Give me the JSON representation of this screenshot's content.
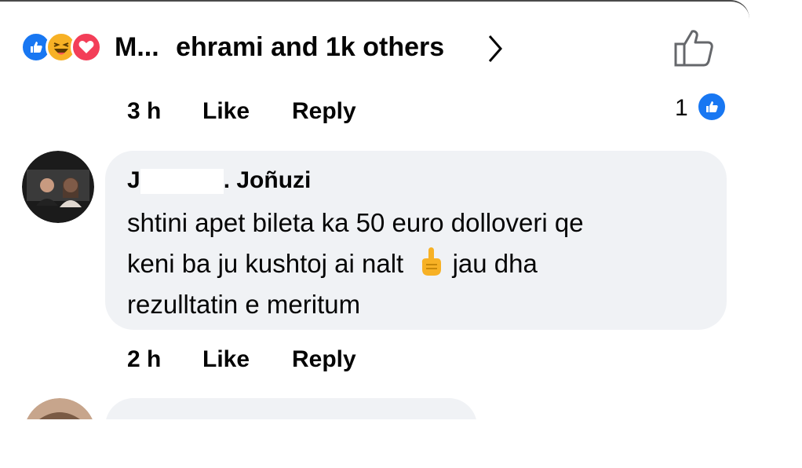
{
  "reactions": {
    "icons": [
      "like-icon",
      "haha-icon",
      "love-icon"
    ],
    "summary": "M... ehrami and 1k others",
    "name_part1": "M...",
    "name_part2": "ehrami and 1k others"
  },
  "post_actions": {
    "time": "3 h",
    "like_label": "Like",
    "reply_label": "Reply",
    "like_count": "1"
  },
  "comment": {
    "author_prefix": "J",
    "author_suffix": ". Joñuzi",
    "text_line1": "shtini apet bileta ka 50 euro dolloveri qe",
    "text_line2_a": "keni ba ju kushtoj ai nalt",
    "text_line2_b": "jau dha",
    "text_line3": "rezulltatin e meritum",
    "time": "2 h",
    "like_label": "Like",
    "reply_label": "Reply"
  },
  "colors": {
    "like_blue": "#1877f2",
    "love_red": "#f33e58",
    "haha_yellow": "#f7b125",
    "bubble_bg": "#f0f2f5",
    "text": "#050505"
  }
}
